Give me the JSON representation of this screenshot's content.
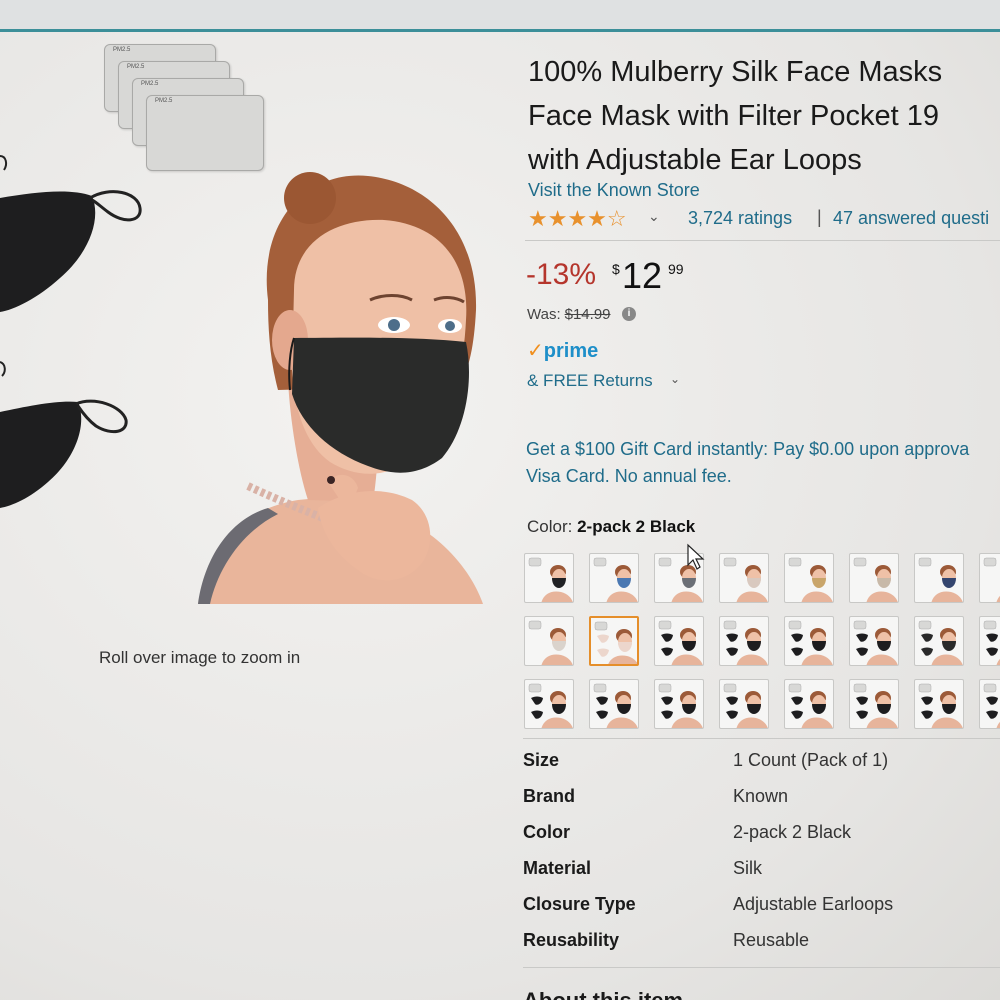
{
  "product": {
    "title_lines": [
      "100% Mulberry Silk Face Masks",
      "Face Mask with Filter Pocket 19",
      "with Adjustable Ear Loops"
    ],
    "store_link": "Visit the Known Store",
    "rating": {
      "stars_glyphs": "★★★★☆",
      "stars_value": 4.5,
      "ratings_count": "3,724 ratings",
      "separator": "|",
      "answered": "47 answered questi"
    },
    "price": {
      "discount": "-13%",
      "currency": "$",
      "whole": "12",
      "fraction": "99",
      "was_label": "Was:",
      "was_value": "$14.99",
      "info_icon": "i"
    },
    "prime": {
      "check": "✓",
      "label": "prime"
    },
    "returns": {
      "label": "& FREE Returns",
      "chevron": "⌄"
    },
    "promo_lines": [
      "Get a $100 Gift Card instantly: Pay $0.00 upon approva",
      "Visa Card. No annual fee."
    ],
    "color": {
      "label": "Color:",
      "selected": "2-pack 2 Black",
      "swatch_count": 24,
      "selected_index": 9
    },
    "specs": [
      {
        "key": "Size",
        "value": "1 Count (Pack of 1)"
      },
      {
        "key": "Brand",
        "value": "Known"
      },
      {
        "key": "Color",
        "value": "2-pack 2 Black"
      },
      {
        "key": "Material",
        "value": "Silk"
      },
      {
        "key": "Closure Type",
        "value": "Adjustable Earloops"
      },
      {
        "key": "Reusability",
        "value": "Reusable"
      }
    ],
    "about_heading": "About this item"
  },
  "image": {
    "zoom_hint": "Roll over image to zoom in",
    "filter_label": "PM2.5"
  },
  "colors": {
    "link": "#1f6c8a",
    "discount": "#b5352c",
    "star": "#e8912d",
    "prime": "#1e8fc9",
    "selected_border": "#e58e2a",
    "accent_rule": "#3c8f99"
  }
}
